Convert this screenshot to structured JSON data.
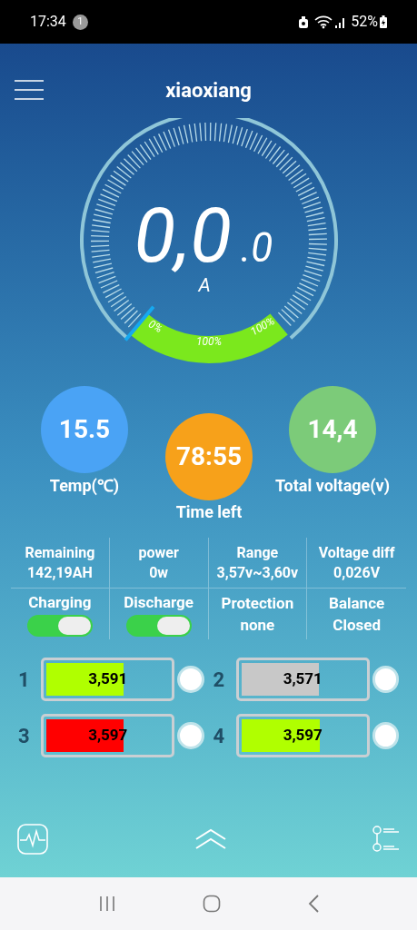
{
  "status_bar": {
    "time": "17:34",
    "notification_count": "1",
    "battery": "52%"
  },
  "header": {
    "title": "xiaoxiang"
  },
  "gauge": {
    "value": "0,0",
    "decimal": ".0",
    "unit": "A",
    "start_label": "0%",
    "mid_label": "100%",
    "end_label": "100%"
  },
  "readouts": [
    {
      "value": "15.5",
      "label": "Temp(℃)",
      "color": "#4aa3f5"
    },
    {
      "value": "78:55",
      "label": "Time left",
      "color": "#f7a11a"
    },
    {
      "value": "14,4",
      "label": "Total voltage(v)",
      "color": "#7ccb79"
    }
  ],
  "stats": [
    {
      "label": "Remaining",
      "value": "142,19AH"
    },
    {
      "label": "power",
      "value": "0w"
    },
    {
      "label": "Range",
      "value": "3,57v~3,60v"
    },
    {
      "label": "Voltage diff",
      "value": "0,026V"
    }
  ],
  "controls": [
    {
      "kind": "switch",
      "label": "Charging",
      "on": true
    },
    {
      "kind": "switch",
      "label": "Discharge",
      "on": true
    },
    {
      "kind": "status",
      "label": "Protection",
      "value": "none"
    },
    {
      "kind": "status",
      "label": "Balance",
      "value": "Closed"
    }
  ],
  "cells": [
    {
      "index": "1",
      "voltage": "3,591",
      "level": 0.63,
      "color": "#b0ff00",
      "balancing": false
    },
    {
      "index": "2",
      "voltage": "3,571",
      "level": 0.63,
      "color": "#c8c8c8",
      "balancing": false
    },
    {
      "index": "3",
      "voltage": "3,597",
      "level": 0.63,
      "color": "#ff0000",
      "balancing": false
    },
    {
      "index": "4",
      "voltage": "3,597",
      "level": 0.64,
      "color": "#b0ff00",
      "balancing": false
    }
  ]
}
